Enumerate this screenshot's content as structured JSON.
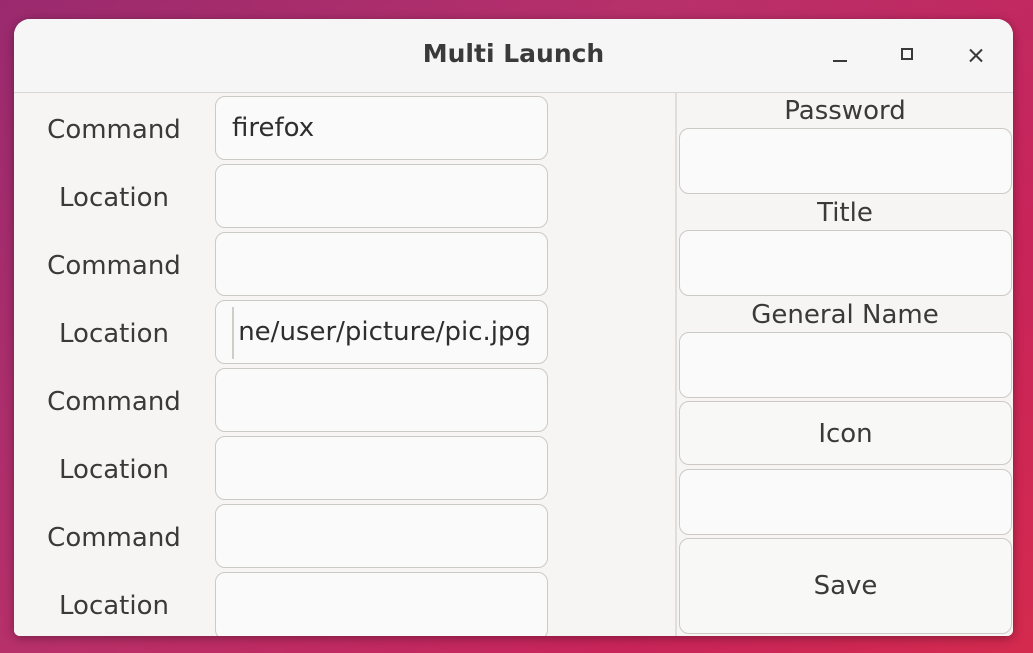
{
  "window": {
    "title": "Multi Launch"
  },
  "rows": [
    {
      "label": "Command",
      "value": "firefox"
    },
    {
      "label": "Location",
      "value": ""
    },
    {
      "label": "Command",
      "value": ""
    },
    {
      "label": "Location",
      "value": "ne/user/picture/pic.jpg"
    },
    {
      "label": "Command",
      "value": ""
    },
    {
      "label": "Location",
      "value": ""
    },
    {
      "label": "Command",
      "value": ""
    },
    {
      "label": "Location",
      "value": ""
    }
  ],
  "right": {
    "password_label": "Password",
    "password_value": "",
    "title_label": "Title",
    "title_value": "",
    "general_name_label": "General Name",
    "general_name_value": "",
    "icon_button": "Icon",
    "icon_value": "",
    "save_button": "Save"
  }
}
